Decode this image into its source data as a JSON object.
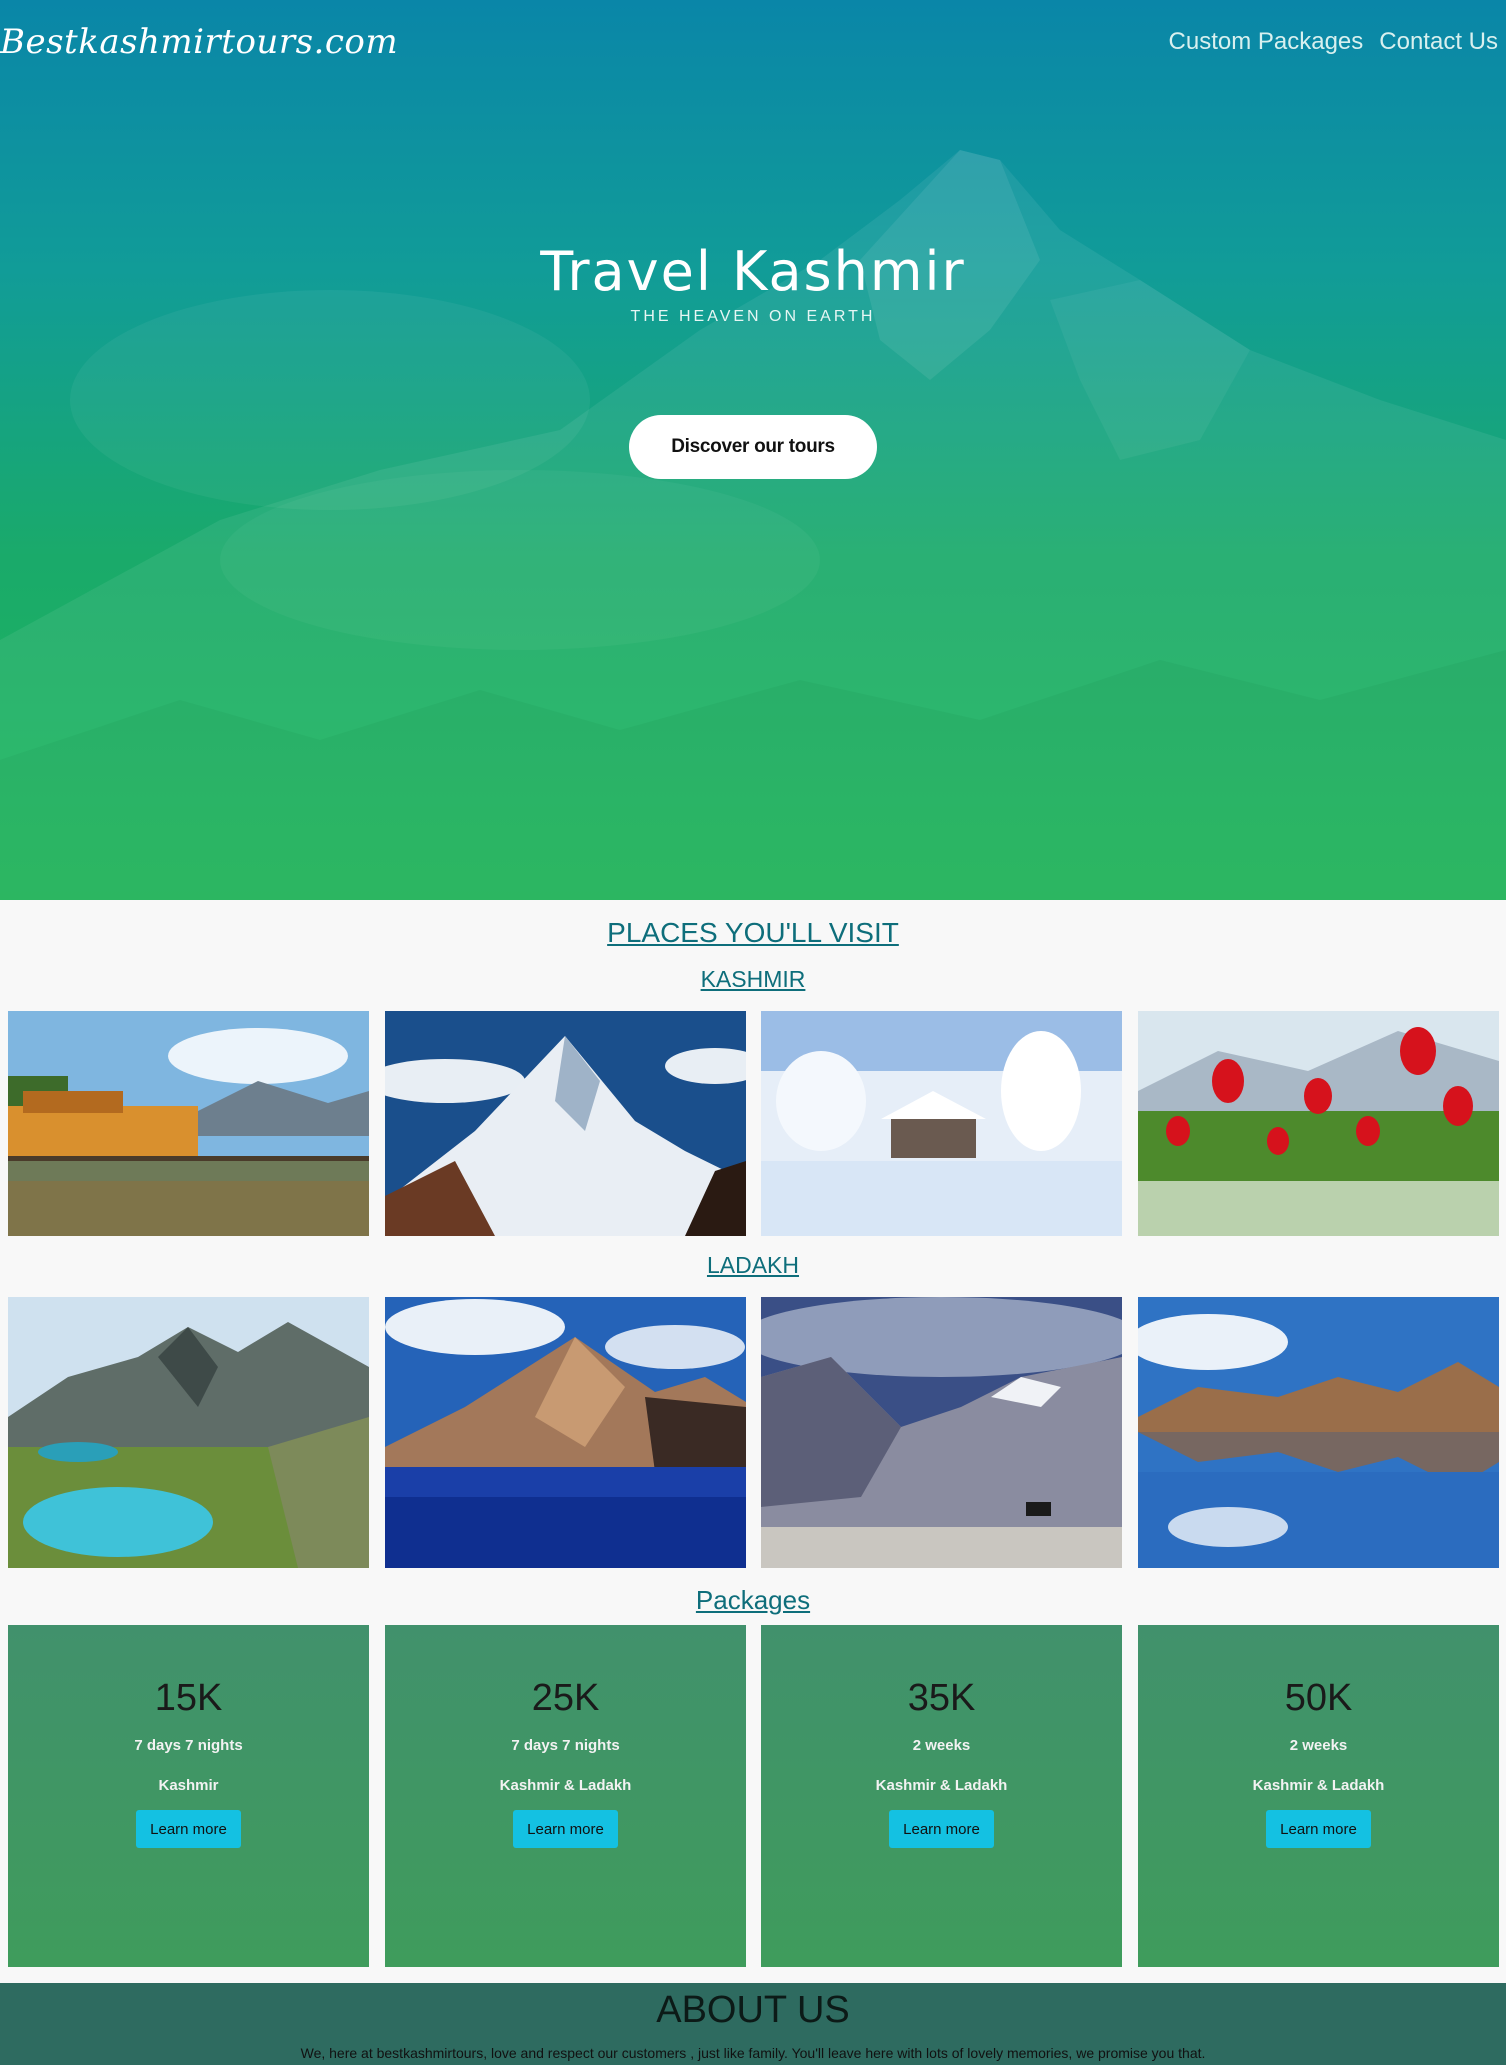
{
  "header": {
    "logo": "Bestkashmirtours.com",
    "nav": [
      "Custom Packages",
      "Contact Us"
    ]
  },
  "hero": {
    "title": "Travel Kashmir",
    "subtitle": "THE HEAVEN ON EARTH",
    "cta": "Discover our tours"
  },
  "places": {
    "heading": "PLACES YOU'LL VISIT",
    "kashmir": {
      "heading": "KASHMIR",
      "images": [
        "houseboats-on-lake",
        "snowy-peak",
        "snow-covered-cabin",
        "red-tulips"
      ]
    },
    "ladakh": {
      "heading": "LADAKH",
      "images": [
        "alpine-lakes-valley",
        "brown-mountain-blue-lake",
        "grey-mountain-valley",
        "lake-reflection"
      ]
    }
  },
  "packages": {
    "heading": "Packages",
    "items": [
      {
        "price": "15K",
        "duration": "7 days 7 nights",
        "destination": "Kashmir",
        "button": "Learn more"
      },
      {
        "price": "25K",
        "duration": "7 days 7 nights",
        "destination": "Kashmir & Ladakh",
        "button": "Learn more"
      },
      {
        "price": "35K",
        "duration": "2 weeks",
        "destination": "Kashmir & Ladakh",
        "button": "Learn more"
      },
      {
        "price": "50K",
        "duration": "2 weeks",
        "destination": "Kashmir & Ladakh",
        "button": "Learn more"
      }
    ]
  },
  "about": {
    "heading": "ABOUT US",
    "text": "We, here at bestkashmirtours, love and respect our customers , just like family. You'll leave here with lots of lovely memories, we promise you that."
  },
  "colors": {
    "hero_top": "#0a86a8",
    "hero_bottom": "#20b95a",
    "section_heading": "#0e6e7b",
    "package_bg": "#41916c",
    "button": "#14c1e2",
    "about_bg": "#2e6b60"
  }
}
